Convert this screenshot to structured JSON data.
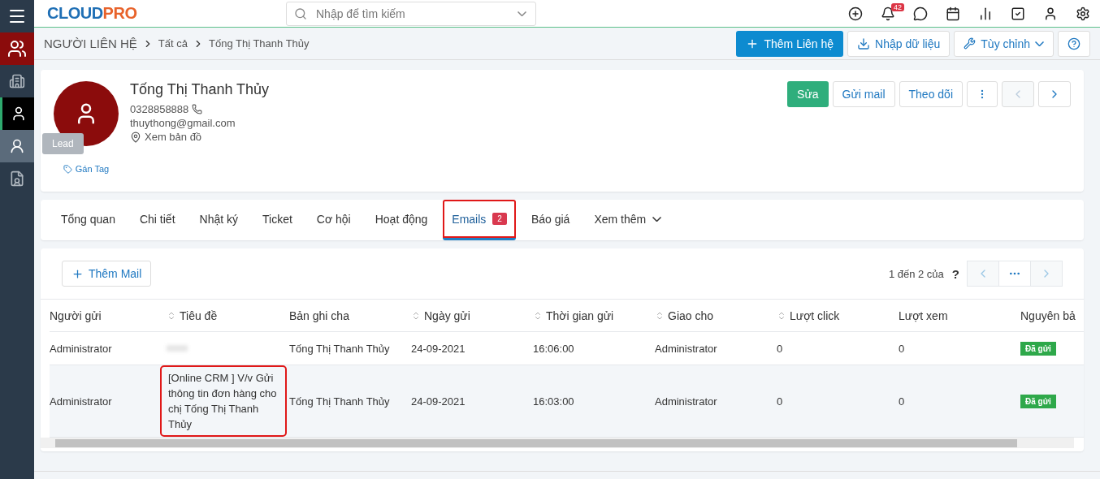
{
  "logo": {
    "text_a": "CLOUD",
    "text_b": "PRO"
  },
  "search": {
    "placeholder": "Nhập để tìm kiếm"
  },
  "notifications": {
    "count": "42"
  },
  "sidebar": {
    "items": [
      {
        "kind": "contacts",
        "selected": true,
        "current": false
      },
      {
        "kind": "company",
        "selected": false,
        "current": false
      },
      {
        "kind": "staff",
        "selected": false,
        "current": true
      },
      {
        "kind": "person",
        "selected": false,
        "current": false,
        "tooltip": "Lead"
      },
      {
        "kind": "document",
        "selected": false,
        "current": false
      }
    ]
  },
  "breadcrumb": [
    "NGƯỜI LIÊN HỆ",
    "Tất cả",
    "Tống Thị Thanh Thủy"
  ],
  "toolbar": {
    "add": "Thêm Liên hệ",
    "import": "Nhập dữ liệu",
    "customize": "Tùy chỉnh"
  },
  "profile": {
    "name": "Tống Thị Thanh Thủy",
    "phone": "0328858888",
    "email": "thuythong@gmail.com",
    "map": "Xem bản đồ",
    "tag": "Gán Tag",
    "actions": [
      {
        "label": "Sửa",
        "primary": true
      },
      {
        "label": "Gửi mail",
        "primary": false
      },
      {
        "label": "Theo dõi",
        "primary": false
      }
    ],
    "prev_disabled": true
  },
  "tabs": [
    {
      "label": "Tổng quan",
      "selected": false
    },
    {
      "label": "Chi tiết",
      "selected": false
    },
    {
      "label": "Nhật ký",
      "selected": false
    },
    {
      "label": "Ticket",
      "selected": false
    },
    {
      "label": "Cơ hội",
      "selected": false
    },
    {
      "label": "Hoạt động",
      "selected": false
    },
    {
      "label": "Emails",
      "selected": true,
      "badge": "2",
      "highlighted": true
    },
    {
      "label": "Báo giá",
      "selected": false
    },
    {
      "label": "Xem thêm",
      "selected": false,
      "dropdown": true
    }
  ],
  "add_mail": "Thêm Mail",
  "pagination": {
    "text": "1 đến 2 của",
    "total": "?"
  },
  "table": {
    "columns": [
      {
        "label": "Người gửi",
        "sortable": false
      },
      {
        "label": "Tiêu đề",
        "sortable": true
      },
      {
        "label": "Bản ghi cha",
        "sortable": false
      },
      {
        "label": "Ngày gửi",
        "sortable": true
      },
      {
        "label": "Thời gian gửi",
        "sortable": true
      },
      {
        "label": "Giao cho",
        "sortable": true
      },
      {
        "label": "Lượt click",
        "sortable": true
      },
      {
        "label": "Lượt xem",
        "sortable": false
      },
      {
        "label": "Nguyên bả",
        "sortable": false
      }
    ],
    "rows": [
      {
        "selected": false,
        "sender": "Administrator",
        "subject_blurred": true,
        "parent": "Tống Thị Thanh Thủy",
        "date": "24-09-2021",
        "time": "16:06:00",
        "assignee": "Administrator",
        "clicks": "0",
        "views": "0",
        "status": "Đã gửi"
      },
      {
        "selected": true,
        "sender": "Administrator",
        "subject": "[Online CRM ] V/v Gửi thông tin đơn hàng cho chị Tống Thị Thanh Thủy",
        "subject_blurred": false,
        "parent": "Tống Thị Thanh Thủy",
        "date": "24-09-2021",
        "time": "16:03:00",
        "assignee": "Administrator",
        "clicks": "0",
        "views": "0",
        "status": "Đã gửi",
        "subject_highlighted": true
      }
    ]
  }
}
